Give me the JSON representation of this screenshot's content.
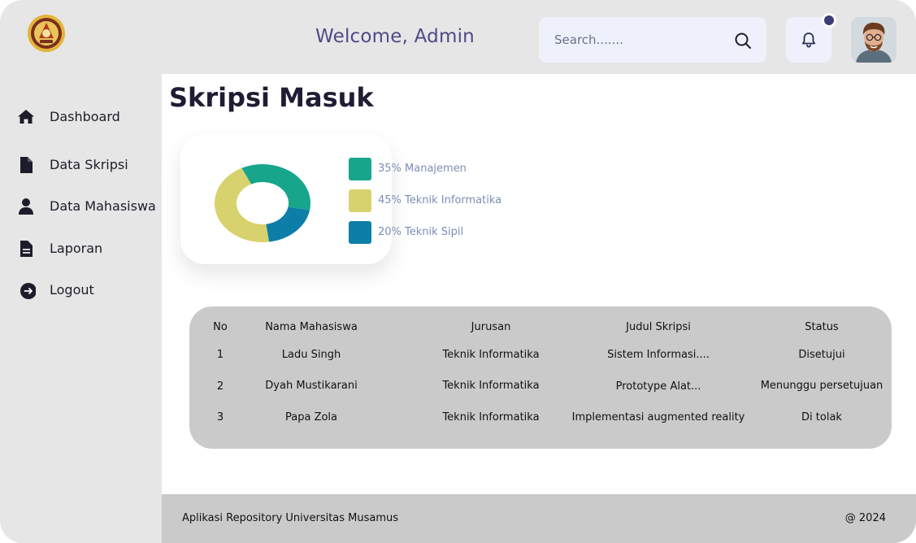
{
  "header": {
    "welcome": "Welcome,  Admin",
    "search_placeholder": "Search.......",
    "notification_dot_color": "#3d3a78"
  },
  "sidebar": {
    "items": [
      {
        "label": "Dashboard",
        "icon": "home-icon"
      },
      {
        "label": "Data Skripsi",
        "icon": "document-icon"
      },
      {
        "label": "Data Mahasiswa",
        "icon": "user-icon"
      },
      {
        "label": "Laporan",
        "icon": "report-icon"
      },
      {
        "label": "Logout",
        "icon": "logout-icon"
      }
    ]
  },
  "main": {
    "title": "Skripsi Masuk"
  },
  "chart_data": {
    "type": "pie",
    "donut": true,
    "categories": [
      "Manajemen",
      "Teknik Informatika",
      "Teknik Sipil"
    ],
    "values": [
      35,
      45,
      20
    ],
    "labels": [
      "35% Manajemen",
      "45% Teknik Informatika",
      "20% Teknik Sipil"
    ],
    "colors": [
      "#17a68c",
      "#d8d26e",
      "#0d7ea8"
    ],
    "legend_position": "right"
  },
  "table": {
    "headers": [
      "No",
      "Nama Mahasiswa",
      "Jurusan",
      "Judul Skripsi",
      "Status"
    ],
    "rows": [
      [
        "1",
        "Ladu Singh",
        "Teknik Informatika",
        "Sistem Informasi....",
        "Disetujui"
      ],
      [
        "2",
        "Dyah Mustikarani",
        "Teknik Informatika",
        "Prototype Alat...",
        "Menunggu persetujuan"
      ],
      [
        "3",
        "Papa Zola",
        "Teknik Informatika",
        "Implementasi augmented reality",
        "Di tolak"
      ]
    ]
  },
  "footer": {
    "left": "Aplikasi Repository Universitas Musamus",
    "right": "@ 2024"
  }
}
